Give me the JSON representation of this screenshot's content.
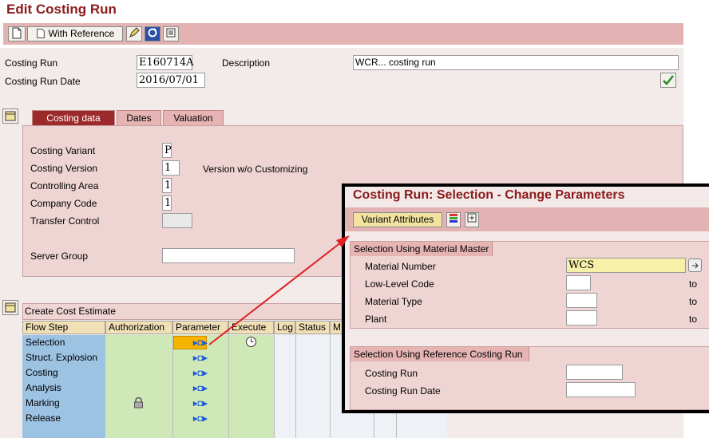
{
  "page_title": "Edit Costing Run",
  "toolbar": {
    "with_reference": "With Reference"
  },
  "header": {
    "costing_run_label": "Costing Run",
    "costing_run_value": "E160714A",
    "costing_run_date_label": "Costing Run Date",
    "costing_run_date_value": "2016/07/01",
    "description_label": "Description",
    "description_value": "WCR... costing run"
  },
  "tabs": [
    {
      "label": "Costing data"
    },
    {
      "label": "Dates"
    },
    {
      "label": "Valuation"
    }
  ],
  "costing_data": {
    "costing_variant_label": "Costing Variant",
    "costing_variant_value": "P",
    "costing_version_label": "Costing Version",
    "costing_version_value": "1",
    "costing_version_text": "Version w/o Customizing",
    "controlling_area_label": "Controlling Area",
    "controlling_area_value": "1",
    "company_code_label": "Company Code",
    "company_code_value": "1",
    "transfer_control_label": "Transfer Control",
    "server_group_label": "Server Group"
  },
  "flow": {
    "section_title": "Create Cost Estimate",
    "columns": [
      "Flow Step",
      "Authorization",
      "Parameter",
      "Execute",
      "Log",
      "Status",
      "M"
    ],
    "steps": [
      "Selection",
      "Struct. Explosion",
      "Costing",
      "Analysis",
      "Marking",
      "Release"
    ]
  },
  "popup": {
    "title": "Costing Run: Selection - Change Parameters",
    "variant_attributes": "Variant Attributes",
    "group1_title": "Selection Using Material Master",
    "material_number_label": "Material Number",
    "material_number_value": "WCS",
    "low_level_code_label": "Low-Level Code",
    "material_type_label": "Material Type",
    "plant_label": "Plant",
    "to_label": "to",
    "group2_title": "Selection Using Reference Costing Run",
    "costing_run_label": "Costing Run",
    "costing_run_date_label": "Costing Run Date"
  },
  "colors": {
    "accent": "#8b1a1a",
    "toolbar_bg": "#e3b3b3",
    "active_tab": "#9c2a2a",
    "arrow": "#e02020"
  },
  "icons": [
    "new-document-icon",
    "edit-pencil-icon",
    "refresh-icon",
    "settings-list-icon",
    "checkmark-icon",
    "collapse-icon",
    "lock-icon",
    "clock-icon",
    "parameter-arrow-icon",
    "color-legend-icon",
    "expand-icon",
    "multiple-selection-icon"
  ]
}
